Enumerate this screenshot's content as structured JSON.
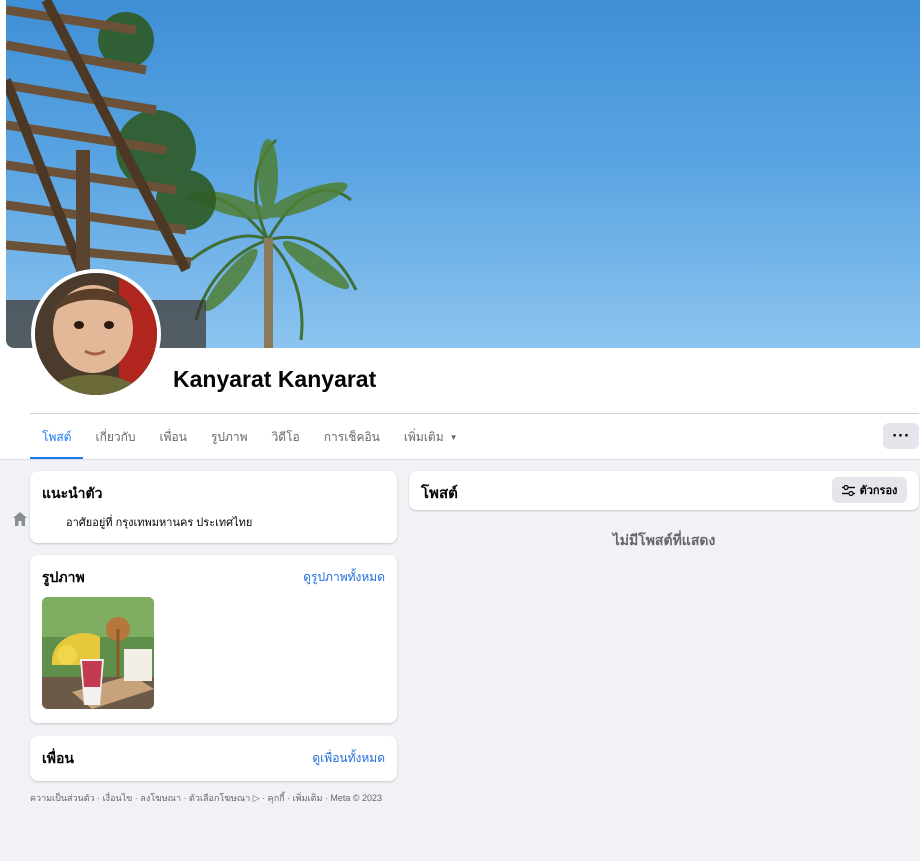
{
  "profile": {
    "name": "Kanyarat Kanyarat"
  },
  "tabs": [
    {
      "label": "โพสต์",
      "active": true
    },
    {
      "label": "เกี่ยวกับ",
      "active": false
    },
    {
      "label": "เพื่อน",
      "active": false
    },
    {
      "label": "รูปภาพ",
      "active": false
    },
    {
      "label": "วิดีโอ",
      "active": false
    },
    {
      "label": "การเช็คอิน",
      "active": false
    },
    {
      "label": "เพิ่มเติม",
      "active": false
    }
  ],
  "more_button": "···",
  "intro": {
    "title": "แนะนำตัว",
    "lives_in_prefix": "อาศัยอยู่ที่",
    "lives_in_value": "กรุงเทพมหานคร ประเทศไทย"
  },
  "photos": {
    "title": "รูปภาพ",
    "see_all": "ดูรูปภาพทั้งหมด"
  },
  "friends": {
    "title": "เพื่อน",
    "see_all": "ดูเพื่อนทั้งหมด"
  },
  "footer": {
    "text": "ความเป็นส่วนตัว · เงื่อนไข · ลงโฆษณา · ตัวเลือกโฆษณา ▷ · คุกกี้ · เพิ่มเติม · Meta © 2023"
  },
  "posts": {
    "title": "โพสต์",
    "filter_label": "ตัวกรอง",
    "empty_message": "ไม่มีโพสต์ที่แสดง"
  },
  "colors": {
    "accent": "#1877f2",
    "link": "#216fdb",
    "background": "#f0f2f5"
  }
}
